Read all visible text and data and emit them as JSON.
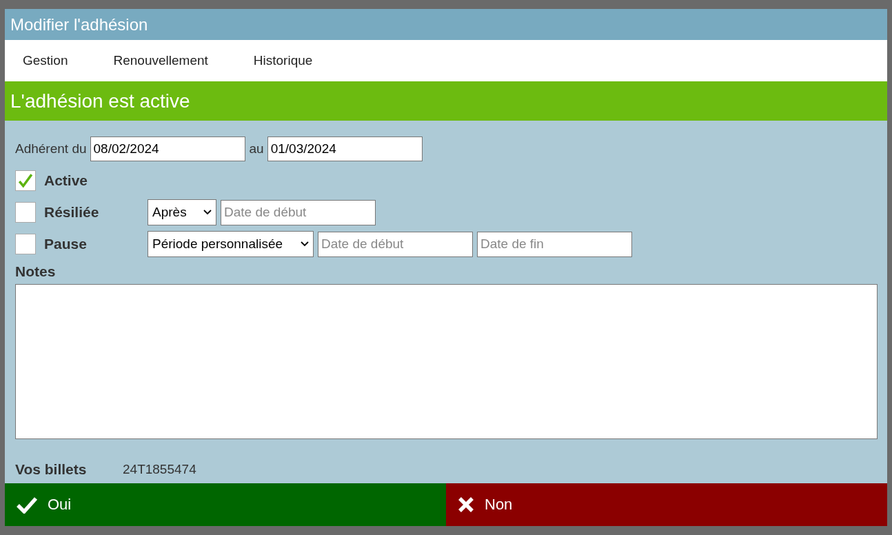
{
  "window": {
    "title": "Modifier l'adhésion"
  },
  "tabs": [
    {
      "label": "Gestion",
      "selected": false
    },
    {
      "label": "Renouvellement",
      "selected": false
    },
    {
      "label": "Historique",
      "selected": false
    }
  ],
  "status_banner": {
    "text": "L'adhésion est active"
  },
  "period": {
    "from_label": "Adhérent du",
    "from_value": "08/02/2024",
    "to_label": "au",
    "to_value": "01/03/2024"
  },
  "options": [
    {
      "kind": "plain",
      "label": "Active",
      "checked": true
    },
    {
      "kind": "cancel",
      "label": "Résiliée",
      "checked": false,
      "select": "Après",
      "start_placeholder": "Date de début"
    },
    {
      "kind": "pause",
      "label": "Pause",
      "checked": false,
      "select": "Période personnalisée",
      "start_placeholder": "Date de début",
      "end_placeholder": "Date de fin"
    }
  ],
  "notes": {
    "label": "Notes"
  },
  "tickets": {
    "label": "Vos billets",
    "value": "24T1855474"
  },
  "buttons": [
    {
      "kind": "confirm",
      "label": "Oui"
    },
    {
      "kind": "reject",
      "label": "Non"
    }
  ]
}
